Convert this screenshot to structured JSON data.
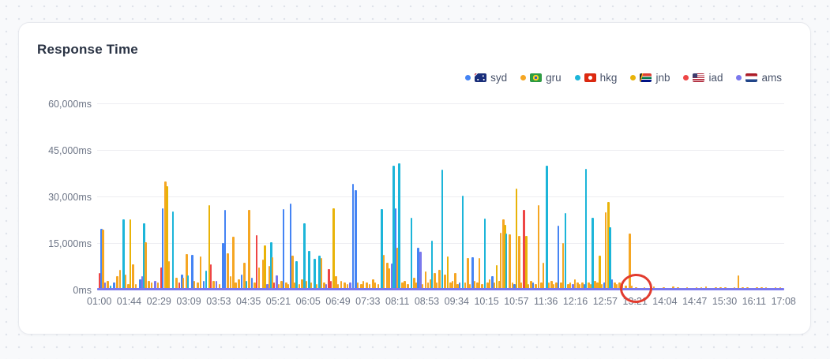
{
  "card": {
    "title": "Response Time"
  },
  "legend": [
    {
      "id": "syd",
      "label": "syd",
      "flag": "au",
      "color": "#4584f4"
    },
    {
      "id": "gru",
      "label": "gru",
      "flag": "br",
      "color": "#f5a623"
    },
    {
      "id": "hkg",
      "label": "hkg",
      "flag": "hk",
      "color": "#1cb5d9"
    },
    {
      "id": "jnb",
      "label": "jnb",
      "flag": "za",
      "color": "#e9b308"
    },
    {
      "id": "iad",
      "label": "iad",
      "flag": "us",
      "color": "#ee4545"
    },
    {
      "id": "ams",
      "label": "ams",
      "flag": "nl",
      "color": "#7b78ed"
    }
  ],
  "annotation": {
    "shape": "circle",
    "color": "#e23b2e",
    "x_t": 0.784,
    "at_value_ms": 0,
    "near_x_label": "13:21"
  },
  "chart_data": {
    "type": "bar",
    "title": "Response Time",
    "xlabel": "",
    "ylabel": "",
    "y_unit": "ms",
    "ylim": [
      0,
      60000
    ],
    "grid": "horizontal",
    "legend_position": "top-right",
    "y_ticks": [
      "0ms",
      "15,000ms",
      "30,000ms",
      "45,000ms",
      "60,000ms"
    ],
    "x_ticks": [
      "01:00",
      "01:44",
      "02:29",
      "03:09",
      "03:53",
      "04:35",
      "05:21",
      "06:05",
      "06:49",
      "07:33",
      "08:11",
      "08:53",
      "09:34",
      "10:15",
      "10:57",
      "11:36",
      "12:16",
      "12:57",
      "13:21",
      "14:04",
      "14:47",
      "15:30",
      "16:11",
      "17:08"
    ],
    "series_ids": [
      "syd",
      "gru",
      "hkg",
      "jnb",
      "iad",
      "ams"
    ],
    "baseline_series": {
      "id": "ams",
      "value_ms": 600
    },
    "bars": [
      [
        0.002,
        "iad",
        5500
      ],
      [
        0.005,
        "syd",
        19800
      ],
      [
        0.007,
        "gru",
        19500
      ],
      [
        0.01,
        "ams",
        2500
      ],
      [
        0.014,
        "gru",
        3000
      ],
      [
        0.018,
        "hkg",
        1500
      ],
      [
        0.023,
        "syd",
        2500
      ],
      [
        0.028,
        "gru",
        4500
      ],
      [
        0.032,
        "gru",
        6500
      ],
      [
        0.037,
        "hkg",
        22800
      ],
      [
        0.04,
        "gru",
        5000
      ],
      [
        0.044,
        "gru",
        2000
      ],
      [
        0.047,
        "jnb",
        22800
      ],
      [
        0.051,
        "gru",
        8500
      ],
      [
        0.055,
        "gru",
        2000
      ],
      [
        0.061,
        "syd",
        3500
      ],
      [
        0.064,
        "ams",
        4700
      ],
      [
        0.067,
        "hkg",
        21500
      ],
      [
        0.069,
        "gru",
        15500
      ],
      [
        0.074,
        "gru",
        3000
      ],
      [
        0.078,
        "gru",
        2500
      ],
      [
        0.083,
        "ams",
        3000
      ],
      [
        0.087,
        "gru",
        2500
      ],
      [
        0.092,
        "iad",
        7400
      ],
      [
        0.094,
        "syd",
        26400
      ],
      [
        0.098,
        "gru",
        35000
      ],
      [
        0.1,
        "jnb",
        33500
      ],
      [
        0.103,
        "gru",
        9400
      ],
      [
        0.109,
        "hkg",
        25400
      ],
      [
        0.114,
        "gru",
        4000
      ],
      [
        0.118,
        "iad",
        2500
      ],
      [
        0.122,
        "syd",
        5100
      ],
      [
        0.124,
        "gru",
        4000
      ],
      [
        0.129,
        "gru",
        11700
      ],
      [
        0.131,
        "hkg",
        4800
      ],
      [
        0.137,
        "syd",
        11400
      ],
      [
        0.14,
        "gru",
        3000
      ],
      [
        0.145,
        "gru",
        2500
      ],
      [
        0.149,
        "gru",
        11000
      ],
      [
        0.154,
        "syd",
        3000
      ],
      [
        0.157,
        "hkg",
        6300
      ],
      [
        0.162,
        "jnb",
        27500
      ],
      [
        0.164,
        "iad",
        8300
      ],
      [
        0.168,
        "gru",
        3000
      ],
      [
        0.172,
        "ams",
        3000
      ],
      [
        0.177,
        "gru",
        2000
      ],
      [
        0.182,
        "syd",
        15300
      ],
      [
        0.185,
        "syd",
        26000
      ],
      [
        0.189,
        "gru",
        12000
      ],
      [
        0.193,
        "gru",
        4500
      ],
      [
        0.197,
        "gru",
        17300
      ],
      [
        0.2,
        "gru",
        2500
      ],
      [
        0.205,
        "gru",
        3500
      ],
      [
        0.209,
        "syd",
        5000
      ],
      [
        0.213,
        "gru",
        9000
      ],
      [
        0.216,
        "hkg",
        3000
      ],
      [
        0.22,
        "gru",
        25900
      ],
      [
        0.224,
        "syd",
        4000
      ],
      [
        0.228,
        "gru",
        2500
      ],
      [
        0.231,
        "iad",
        17800
      ],
      [
        0.234,
        "gru",
        7400
      ],
      [
        0.24,
        "gru",
        9900
      ],
      [
        0.243,
        "jnb",
        14500
      ],
      [
        0.246,
        "ams",
        2000
      ],
      [
        0.249,
        "gru",
        8000
      ],
      [
        0.252,
        "hkg",
        15500
      ],
      [
        0.254,
        "gru",
        10700
      ],
      [
        0.256,
        "iad",
        2500
      ],
      [
        0.26,
        "ams",
        4800
      ],
      [
        0.263,
        "gru",
        2000
      ],
      [
        0.267,
        "gru",
        3000
      ],
      [
        0.27,
        "syd",
        26200
      ],
      [
        0.274,
        "gru",
        2500
      ],
      [
        0.277,
        "gru",
        2000
      ],
      [
        0.28,
        "syd",
        28000
      ],
      [
        0.283,
        "gru",
        11200
      ],
      [
        0.286,
        "gru",
        2500
      ],
      [
        0.289,
        "hkg",
        9400
      ],
      [
        0.293,
        "gru",
        2000
      ],
      [
        0.297,
        "gru",
        3500
      ],
      [
        0.3,
        "hkg",
        21600
      ],
      [
        0.303,
        "gru",
        3000
      ],
      [
        0.307,
        "hkg",
        12700
      ],
      [
        0.31,
        "gru",
        2500
      ],
      [
        0.315,
        "hkg",
        10200
      ],
      [
        0.318,
        "gru",
        2000
      ],
      [
        0.322,
        "hkg",
        11200
      ],
      [
        0.325,
        "gru",
        10500
      ],
      [
        0.329,
        "gru",
        2500
      ],
      [
        0.332,
        "ams",
        2000
      ],
      [
        0.336,
        "iad",
        6900
      ],
      [
        0.339,
        "iad",
        3000
      ],
      [
        0.343,
        "jnb",
        26500
      ],
      [
        0.346,
        "gru",
        4500
      ],
      [
        0.349,
        "gru",
        2000
      ],
      [
        0.354,
        "gru",
        3000
      ],
      [
        0.359,
        "gru",
        2500
      ],
      [
        0.363,
        "gru",
        2000
      ],
      [
        0.367,
        "ams",
        2500
      ],
      [
        0.371,
        "syd",
        34300
      ],
      [
        0.375,
        "syd",
        32300
      ],
      [
        0.378,
        "gru",
        2500
      ],
      [
        0.383,
        "gru",
        2000
      ],
      [
        0.386,
        "gru",
        3000
      ],
      [
        0.391,
        "gru",
        2500
      ],
      [
        0.395,
        "gru",
        2000
      ],
      [
        0.4,
        "gru",
        3500
      ],
      [
        0.403,
        "gru",
        2500
      ],
      [
        0.408,
        "gru",
        2000
      ],
      [
        0.413,
        "hkg",
        26200
      ],
      [
        0.416,
        "gru",
        11500
      ],
      [
        0.421,
        "gru",
        9000
      ],
      [
        0.424,
        "gru",
        7000
      ],
      [
        0.428,
        "ams",
        8600
      ],
      [
        0.43,
        "hkg",
        40100
      ],
      [
        0.433,
        "syd",
        26400
      ],
      [
        0.436,
        "gru",
        13700
      ],
      [
        0.438,
        "hkg",
        40900
      ],
      [
        0.443,
        "gru",
        2500
      ],
      [
        0.446,
        "gru",
        3000
      ],
      [
        0.451,
        "gru",
        2000
      ],
      [
        0.456,
        "hkg",
        23400
      ],
      [
        0.46,
        "gru",
        4000
      ],
      [
        0.463,
        "gru",
        2500
      ],
      [
        0.466,
        "syd",
        13700
      ],
      [
        0.469,
        "ams",
        12500
      ],
      [
        0.472,
        "gru",
        2000
      ],
      [
        0.477,
        "gru",
        6000
      ],
      [
        0.48,
        "gru",
        2500
      ],
      [
        0.484,
        "gru",
        3500
      ],
      [
        0.486,
        "hkg",
        16000
      ],
      [
        0.49,
        "gru",
        5500
      ],
      [
        0.493,
        "gru",
        2500
      ],
      [
        0.497,
        "gru",
        6500
      ],
      [
        0.501,
        "hkg",
        38800
      ],
      [
        0.505,
        "gru",
        5000
      ],
      [
        0.509,
        "jnb",
        10900
      ],
      [
        0.513,
        "gru",
        2500
      ],
      [
        0.516,
        "gru",
        3000
      ],
      [
        0.52,
        "gru",
        5500
      ],
      [
        0.523,
        "gru",
        2000
      ],
      [
        0.526,
        "syd",
        2500
      ],
      [
        0.531,
        "hkg",
        30500
      ],
      [
        0.534,
        "gru",
        2500
      ],
      [
        0.538,
        "gru",
        10500
      ],
      [
        0.541,
        "gru",
        2000
      ],
      [
        0.545,
        "syd",
        10800
      ],
      [
        0.548,
        "gru",
        3000
      ],
      [
        0.552,
        "gru",
        2500
      ],
      [
        0.555,
        "gru",
        10500
      ],
      [
        0.559,
        "gru",
        2000
      ],
      [
        0.563,
        "hkg",
        23100
      ],
      [
        0.567,
        "gru",
        2500
      ],
      [
        0.57,
        "gru",
        3500
      ],
      [
        0.574,
        "syd",
        4500
      ],
      [
        0.577,
        "gru",
        2500
      ],
      [
        0.58,
        "jnb",
        8100
      ],
      [
        0.584,
        "gru",
        3000
      ],
      [
        0.586,
        "gru",
        18500
      ],
      [
        0.59,
        "gru",
        22900
      ],
      [
        0.592,
        "jnb",
        21100
      ],
      [
        0.594,
        "hkg",
        18300
      ],
      [
        0.599,
        "gru",
        18000
      ],
      [
        0.603,
        "gru",
        2500
      ],
      [
        0.606,
        "syd",
        2000
      ],
      [
        0.609,
        "jnb",
        32800
      ],
      [
        0.613,
        "gru",
        17500
      ],
      [
        0.616,
        "gru",
        2500
      ],
      [
        0.62,
        "iad",
        25900
      ],
      [
        0.623,
        "jnb",
        17500
      ],
      [
        0.626,
        "gru",
        2000
      ],
      [
        0.63,
        "gru",
        3000
      ],
      [
        0.633,
        "syd",
        2500
      ],
      [
        0.637,
        "gru",
        2000
      ],
      [
        0.641,
        "gru",
        27400
      ],
      [
        0.645,
        "gru",
        2500
      ],
      [
        0.648,
        "gru",
        8900
      ],
      [
        0.653,
        "hkg",
        40100
      ],
      [
        0.656,
        "gru",
        2500
      ],
      [
        0.66,
        "gru",
        3000
      ],
      [
        0.663,
        "gru",
        2000
      ],
      [
        0.667,
        "gru",
        2500
      ],
      [
        0.67,
        "syd",
        20800
      ],
      [
        0.674,
        "gru",
        2500
      ],
      [
        0.677,
        "gru",
        15200
      ],
      [
        0.68,
        "hkg",
        24800
      ],
      [
        0.684,
        "gru",
        2000
      ],
      [
        0.687,
        "gru",
        2500
      ],
      [
        0.691,
        "ams",
        2000
      ],
      [
        0.694,
        "gru",
        3500
      ],
      [
        0.698,
        "gru",
        2500
      ],
      [
        0.701,
        "gru",
        2000
      ],
      [
        0.705,
        "gru",
        2500
      ],
      [
        0.708,
        "syd",
        2000
      ],
      [
        0.71,
        "hkg",
        39100
      ],
      [
        0.714,
        "gru",
        2500
      ],
      [
        0.717,
        "gru",
        2000
      ],
      [
        0.72,
        "hkg",
        23300
      ],
      [
        0.723,
        "gru",
        3000
      ],
      [
        0.727,
        "gru",
        2500
      ],
      [
        0.73,
        "jnb",
        11200
      ],
      [
        0.733,
        "gru",
        2000
      ],
      [
        0.737,
        "syd",
        2500
      ],
      [
        0.739,
        "gru",
        25100
      ],
      [
        0.743,
        "jnb",
        28400
      ],
      [
        0.745,
        "hkg",
        20300
      ],
      [
        0.748,
        "syd",
        3500
      ],
      [
        0.752,
        "gru",
        2500
      ],
      [
        0.755,
        "gru",
        2000
      ],
      [
        0.759,
        "gru",
        2500
      ],
      [
        0.763,
        "gru",
        2000
      ],
      [
        0.768,
        "gru",
        1500
      ],
      [
        0.774,
        "gru",
        18300
      ],
      [
        0.777,
        "gru",
        1500
      ],
      [
        0.783,
        "gru",
        900
      ],
      [
        0.789,
        "ams",
        800
      ],
      [
        0.795,
        "gru",
        1100
      ],
      [
        0.802,
        "gru",
        800
      ],
      [
        0.809,
        "gru",
        1200
      ],
      [
        0.816,
        "ams",
        700
      ],
      [
        0.823,
        "gru",
        1000
      ],
      [
        0.83,
        "gru",
        800
      ],
      [
        0.837,
        "gru",
        1300
      ],
      [
        0.844,
        "gru",
        900
      ],
      [
        0.851,
        "gru",
        800
      ],
      [
        0.857,
        "gru",
        1100
      ],
      [
        0.864,
        "ams",
        800
      ],
      [
        0.871,
        "gru",
        1000
      ],
      [
        0.878,
        "gru",
        900
      ],
      [
        0.885,
        "gru",
        1200
      ],
      [
        0.892,
        "gru",
        800
      ],
      [
        0.899,
        "gru",
        1000
      ],
      [
        0.906,
        "gru",
        900
      ],
      [
        0.913,
        "gru",
        1100
      ],
      [
        0.92,
        "gru",
        800
      ],
      [
        0.926,
        "gru",
        1000
      ],
      [
        0.932,
        "gru",
        4800
      ],
      [
        0.938,
        "gru",
        900
      ],
      [
        0.945,
        "gru",
        1100
      ],
      [
        0.952,
        "gru",
        800
      ],
      [
        0.959,
        "gru",
        1000
      ],
      [
        0.966,
        "gru",
        900
      ],
      [
        0.972,
        "gru",
        1100
      ],
      [
        0.979,
        "gru",
        800
      ],
      [
        0.986,
        "gru",
        1000
      ],
      [
        0.993,
        "gru",
        900
      ]
    ]
  }
}
